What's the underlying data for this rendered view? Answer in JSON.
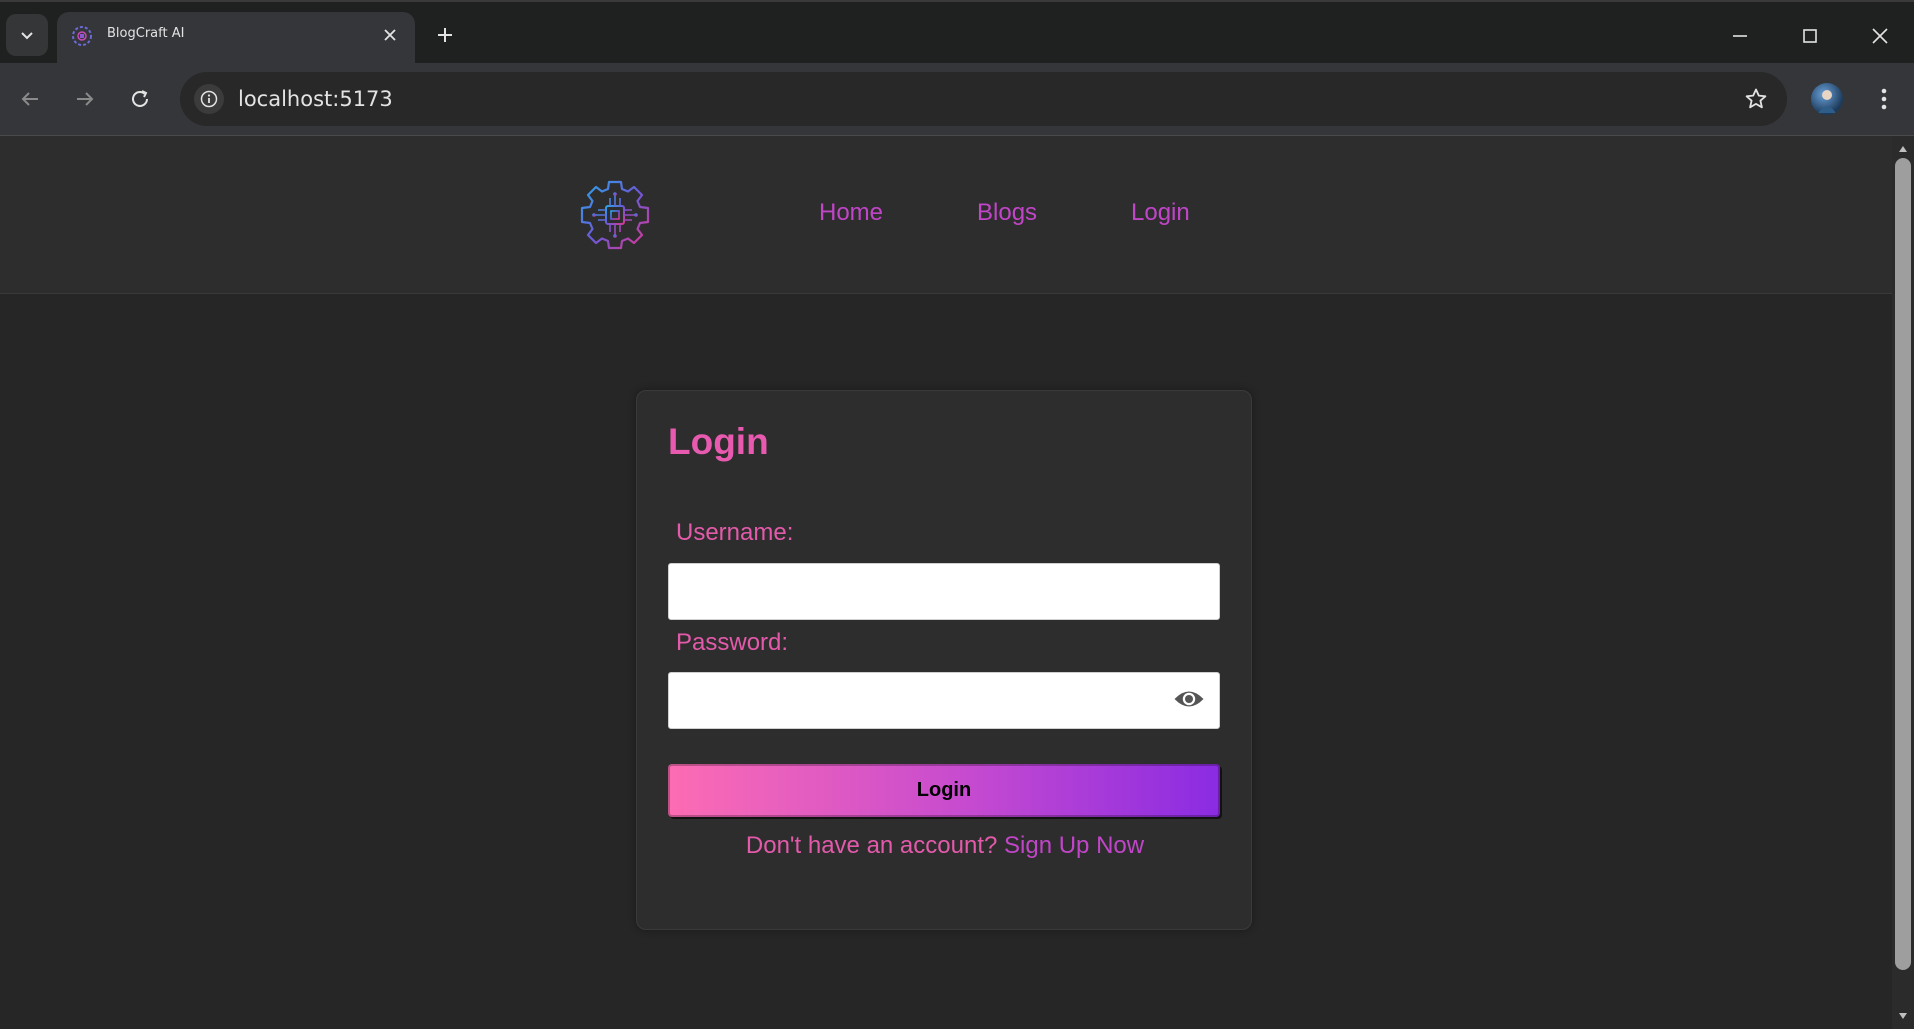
{
  "browser": {
    "tab_title": "BlogCraft AI",
    "url": "localhost:5173",
    "icons": {
      "tab_list": "chevron-down-icon",
      "close_tab": "close-icon",
      "new_tab": "plus-icon",
      "minimize": "minimize-icon",
      "maximize": "maximize-icon",
      "close_window": "close-icon",
      "back": "arrow-left-icon",
      "forward": "arrow-right-icon",
      "reload": "reload-icon",
      "site_info": "info-icon",
      "bookmark": "star-icon",
      "menu": "kebab-menu-icon"
    }
  },
  "header": {
    "logo_icon": "gear-circuit-icon",
    "nav": [
      {
        "label": "Home"
      },
      {
        "label": "Blogs"
      },
      {
        "label": "Login"
      }
    ]
  },
  "login_card": {
    "title": "Login",
    "username_label": "Username:",
    "username_value": "",
    "password_label": "Password:",
    "password_value": "",
    "show_password_icon": "eye-icon",
    "submit_label": "Login",
    "signup_prompt": "Don't have an account?",
    "signup_link": "Sign Up Now"
  },
  "colors": {
    "accent_pink": "#e35aaa",
    "accent_purple": "#c145c8",
    "button_gradient_start": "#fd6cb3",
    "button_gradient_end": "#8a2be2",
    "page_background": "#262626"
  }
}
